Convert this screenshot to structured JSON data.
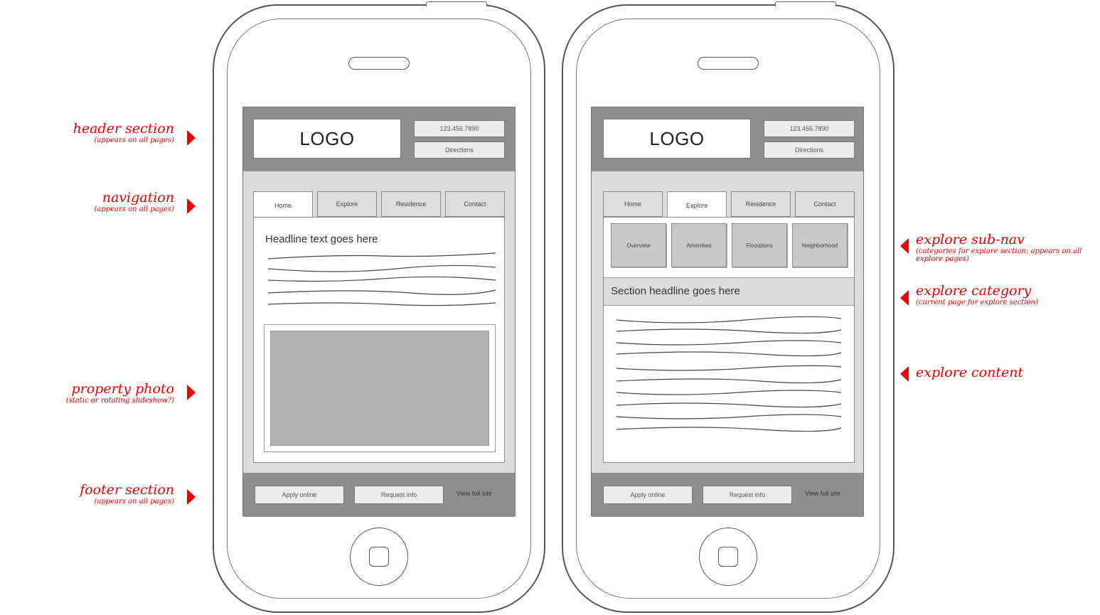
{
  "phone1": {
    "logo": "LOGO",
    "header_buttons": [
      "123.456.7890",
      "Directions"
    ],
    "tabs": [
      "Home",
      "Explore",
      "Residence",
      "Contact"
    ],
    "active_tab": 0,
    "headline": "Headline text goes here",
    "footer_buttons": [
      "Apply online",
      "Request info"
    ],
    "footer_link": "View full site"
  },
  "phone2": {
    "logo": "LOGO",
    "header_buttons": [
      "123.456.7890",
      "Directions"
    ],
    "tabs": [
      "Home",
      "Explore",
      "Residence",
      "Contact"
    ],
    "active_tab": 1,
    "subnav": [
      "Overview",
      "Amenities",
      "Floorplans",
      "Neighborhood"
    ],
    "section_headline": "Section headline goes here",
    "footer_buttons": [
      "Apply online",
      "Request info"
    ],
    "footer_link": "View full site"
  },
  "annotations_left": [
    {
      "title": "header section",
      "sub": "(appears on all pages)"
    },
    {
      "title": "navigation",
      "sub": "(appears on all pages)"
    },
    {
      "title": "property photo",
      "sub": "(static or rotating slideshow?)"
    },
    {
      "title": "footer section",
      "sub": "(appears on all pages)"
    }
  ],
  "annotations_right": [
    {
      "title": "explore sub-nav",
      "sub": "(categories for explore section; appears on all explore pages)"
    },
    {
      "title": "explore category",
      "sub": "(current page for explore section)"
    },
    {
      "title": "explore content",
      "sub": ""
    }
  ],
  "colors": {
    "annotation": "#e00000",
    "frame_gray": "#8f8f8f",
    "panel_gray": "#dcdcdc"
  }
}
